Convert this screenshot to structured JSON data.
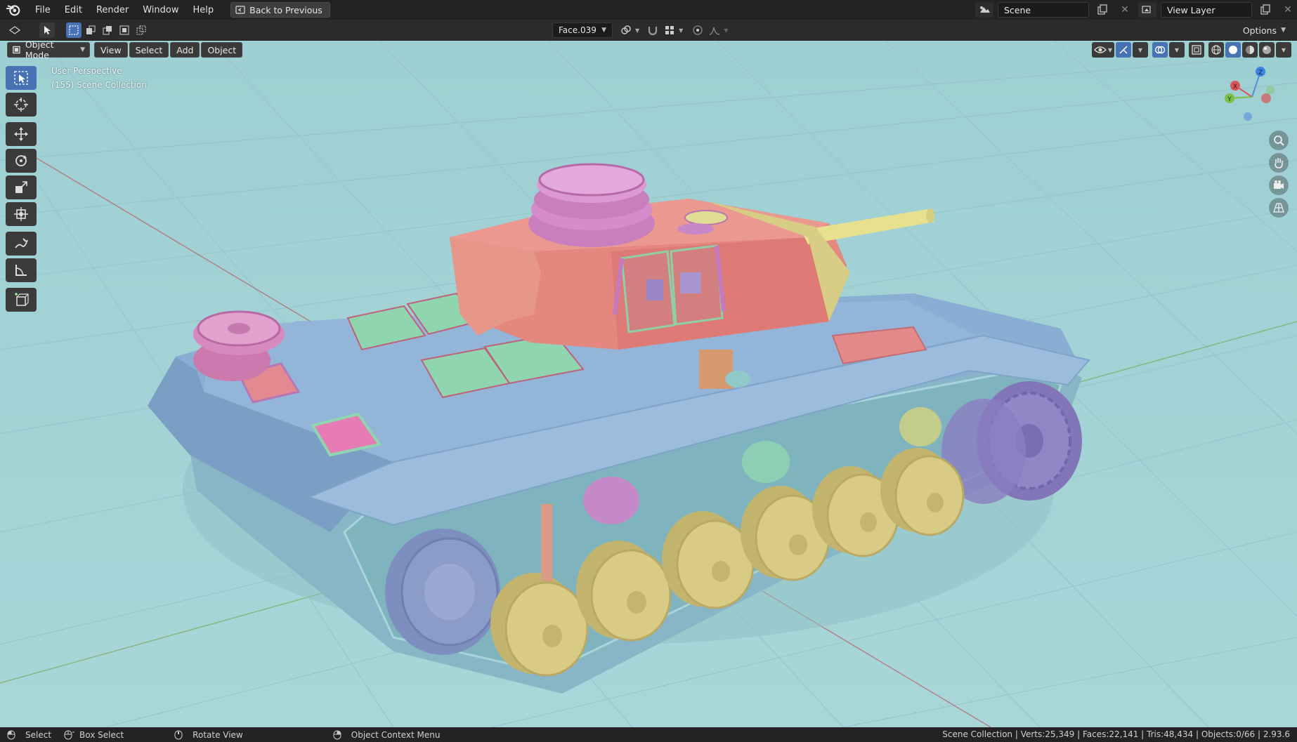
{
  "menu": {
    "items": [
      "File",
      "Edit",
      "Render",
      "Window",
      "Help"
    ],
    "back_label": "Back to Previous"
  },
  "top_right": {
    "scene_label": "Scene",
    "view_layer_label": "View Layer"
  },
  "tool_header": {
    "face_dropdown": "Face.039",
    "options_label": "Options"
  },
  "viewport": {
    "mode_label": "Object Mode",
    "menus": [
      "View",
      "Select",
      "Add",
      "Object"
    ],
    "overlay_line1": "User Perspective",
    "overlay_line2": "(155) Scene Collection",
    "background_color": "#a4d3d6",
    "gizmo": {
      "x_label": "X",
      "y_label": "Y",
      "z_label": "Z"
    }
  },
  "status": {
    "select": "Select",
    "box_select": "Box Select",
    "rotate_view": "Rotate View",
    "context_menu": "Object Context Menu",
    "stats": "Scene Collection | Verts:25,349 | Faces:22,141 | Tris:48,434 | Objects:0/66 | 2.93.6"
  }
}
